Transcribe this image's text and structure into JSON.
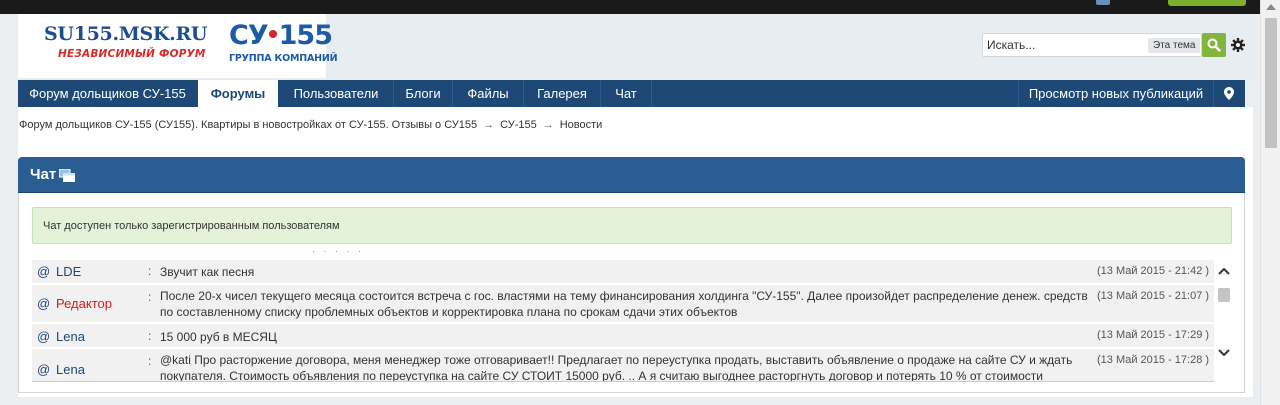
{
  "site": {
    "logo_msk": "SU155.MSK.RU",
    "logo_slogan": "НЕЗАВИСИМЫЙ ФОРУМ",
    "logo_su": "СУ",
    "logo_su_num": "155",
    "logo_group": "ГРУППА КОМПАНИЙ"
  },
  "search": {
    "placeholder": "Искать...",
    "scope_label": "Эта тема"
  },
  "nav": {
    "items": [
      {
        "label": "Форум дольщиков СУ-155",
        "active": false
      },
      {
        "label": "Форумы",
        "active": true
      },
      {
        "label": "Пользователи",
        "active": false
      },
      {
        "label": "Блоги",
        "active": false
      },
      {
        "label": "Файлы",
        "active": false
      },
      {
        "label": "Галерея",
        "active": false
      },
      {
        "label": "Чат",
        "active": false
      }
    ],
    "right_item": "Просмотр новых публикаций"
  },
  "breadcrumb": {
    "items": [
      "Форум дольщиков СУ-155 (СУ155). Квартиры в новостройках от СУ-155. Отзывы о СУ155",
      "СУ-155",
      "Новости"
    ],
    "separator": "→"
  },
  "chat": {
    "title": "Чат",
    "notice": "Чат доступен только зарегистрированным пользователям",
    "messages": [
      {
        "at": "@",
        "user": "LDE",
        "user_color": "#1e4977",
        "colon": ":",
        "text": "Звучит как песня",
        "time": "(13 Май 2015 - 21:42 )"
      },
      {
        "at": "@",
        "user": "Редактор",
        "user_color": "#d11b1b",
        "colon": ":",
        "text": "После 20-х чисел текущего месяца состоится встреча с гос. властями на тему финансирования холдинга \"СУ-155\". Далее произойдет распределение денеж. средств по составленному списку проблемных объектов и корректировка плана по срокам сдачи этих объектов",
        "time": "(13 Май 2015 - 21:07 )"
      },
      {
        "at": "@",
        "user": "Lena",
        "user_color": "#1e4977",
        "colon": ":",
        "text": "15 000 руб в МЕСЯЦ",
        "time": "(13 Май 2015 - 17:29 )"
      },
      {
        "at": "@",
        "user": "Lena",
        "user_color": "#1e4977",
        "colon": ":",
        "text": "@kati Про расторжение договора, меня менеджер тоже отговаривает!! Предлагает по переуступка продать, выставить объявление о продаже на сайте СУ и ждать покупателя. Стоимость объявления по переуступка на сайте СУ СТОИТ 15000 руб. .. А я считаю выгоднее расторгнуть договор и потерять 10 % от стоимости",
        "time": "(13 Май 2015 - 17:28 )"
      }
    ]
  },
  "colors": {
    "nav_bg": "#1e4977",
    "chat_head_bg": "#2a5d92",
    "search_button": "#82b440",
    "notice_bg": "#e4f2d9",
    "moderator_name": "#d11b1b"
  }
}
